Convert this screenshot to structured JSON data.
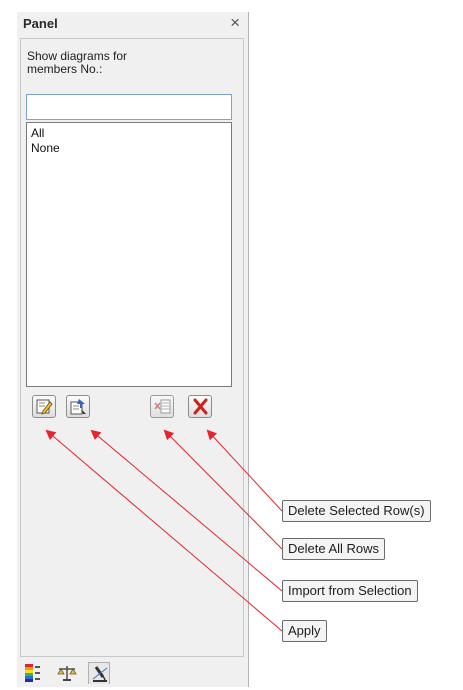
{
  "panel": {
    "title": "Panel",
    "close_glyph": "×",
    "caption": "Show diagrams for\nmembers No.:",
    "input_value": "",
    "list_items": [
      "All",
      "None"
    ]
  },
  "toolbar": {
    "buttons": [
      {
        "name": "apply",
        "icon": "edit-pencil-icon"
      },
      {
        "name": "import-from-selection",
        "icon": "import-select-icon"
      },
      {
        "name": "delete-all-rows",
        "icon": "delete-rows-icon"
      },
      {
        "name": "delete-selected-rows",
        "icon": "red-x-icon"
      }
    ]
  },
  "bottom_tabs": [
    {
      "icon": "color-scale-icon"
    },
    {
      "icon": "balance-scale-icon"
    },
    {
      "icon": "microscope-icon"
    }
  ],
  "callouts": {
    "delete_selected_rows": "Delete Selected Row(s)",
    "delete_all_rows": "Delete All Rows",
    "import_from_selection": "Import from Selection",
    "apply": "Apply"
  },
  "colors": {
    "arrow": "#e8232b",
    "panel_bg": "#f0f0f0",
    "input_border": "#7aa3d3"
  }
}
